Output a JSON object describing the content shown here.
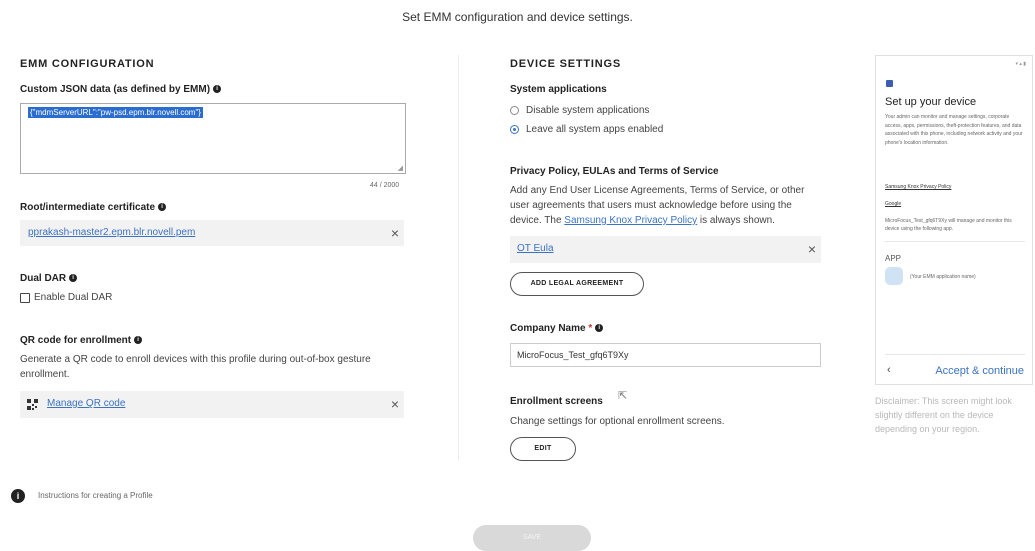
{
  "header": {
    "title": "Set EMM configuration and device settings."
  },
  "emm": {
    "section_title": "EMM CONFIGURATION",
    "json_label": "Custom JSON data (as defined by EMM)",
    "json_value": "{\"mdmServerURL\":\"pw-psd.epm.blr.novell.com\"}",
    "json_counter": "44 / 2000",
    "cert_label": "Root/intermediate certificate",
    "cert_file": "pprakash-master2.epm.blr.novell.pem",
    "dual_dar_label": "Dual DAR",
    "dual_dar_checkbox": "Enable Dual DAR",
    "qr_label": "QR code for enrollment",
    "qr_desc": "Generate a QR code to enroll devices with this profile during out-of-box gesture enrollment.",
    "qr_link": "Manage QR code"
  },
  "device": {
    "section_title": "DEVICE SETTINGS",
    "sys_apps_label": "System applications",
    "sys_apps_options": [
      "Disable system applications",
      "Leave all system apps enabled"
    ],
    "sys_apps_selected": "Leave all system apps enabled",
    "privacy_label": "Privacy Policy, EULAs and Terms of Service",
    "privacy_desc_pre": "Add any End User License Agreements, Terms of Service, or other user agreements that users must acknowledge before using the device. The",
    "privacy_link": "Samsung Knox Privacy Policy",
    "privacy_desc_post": "is always shown.",
    "eula_item": "OT Eula",
    "add_legal_button": "ADD LEGAL AGREEMENT",
    "company_label": "Company Name",
    "company_required": "*",
    "company_value": "MicroFocus_Test_gfq6T9Xy",
    "enroll_label": "Enrollment screens",
    "enroll_desc": "Change settings for optional enrollment screens.",
    "edit_button": "EDIT"
  },
  "phone": {
    "status": "▾ ▴ ▮",
    "title": "Set up your device",
    "desc": "Your admin can monitor and manage settings, corporate access, apps, permissions, theft-protection features, and data associated with this phone, including network activity and your phone's location information.",
    "privacy_link": "Samsung Knox Privacy Policy",
    "google_link": "Google",
    "manage_text": "MicroFocus_Test_gfq6T9Xy will manage and monitor this device using the following app.",
    "app_label": "APP",
    "app_name": "(Your EMM application name)",
    "back": "‹",
    "accept": "Accept & continue"
  },
  "disclaimer": "Disclaimer: This screen might look slightly different on the device depending on your region.",
  "footer": {
    "help_text": "Instructions for creating a Profile",
    "save_button": "SAVE"
  },
  "icons": {
    "info": "i",
    "close": "×",
    "help": "i",
    "cursor": "⇱"
  },
  "colors": {
    "link": "#3b73c2",
    "selection": "#2a6ccf",
    "save_disabled": "#d9d9d9"
  }
}
